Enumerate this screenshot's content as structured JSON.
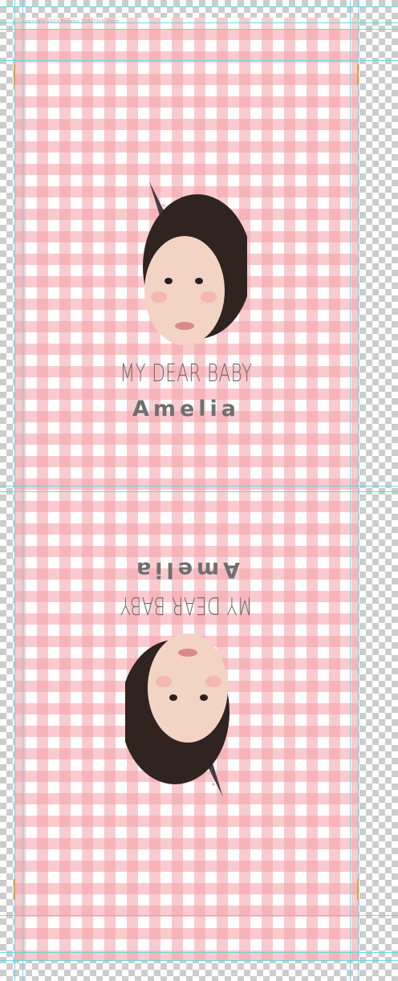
{
  "document": {
    "header_text": "Copyright 2023 Bonamy 196x73x0,25cm"
  },
  "labels": [
    {
      "line1": "MY DEAR BABY",
      "line2": "Amelia"
    },
    {
      "line1": "MY DEAR BABY",
      "line2": "Amelia"
    }
  ],
  "colors": {
    "gingham_pink": "#f4a0a8",
    "text_gray": "#6f6f6f",
    "guide_cyan": "#56d6e6"
  }
}
